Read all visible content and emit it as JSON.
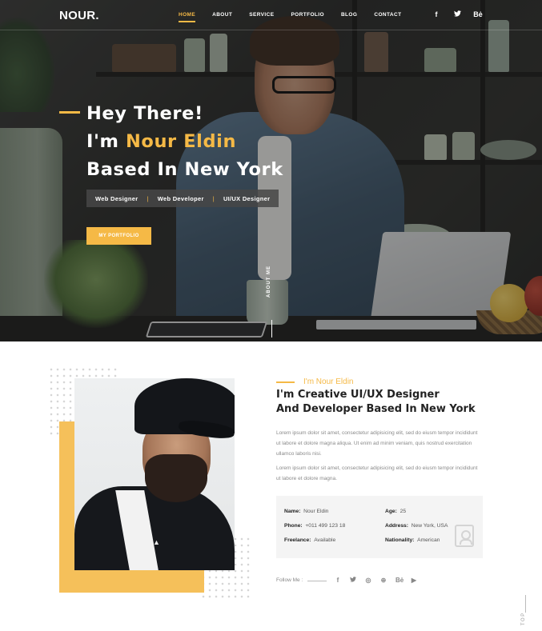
{
  "brand": {
    "logo": "NOUR."
  },
  "nav": {
    "items": [
      "HOME",
      "ABOUT",
      "SERVICE",
      "PORTFOLIO",
      "BLOG",
      "CONTACT"
    ],
    "active": "HOME",
    "socials": [
      {
        "icon": "facebook-icon",
        "glyph": "f"
      },
      {
        "icon": "twitter-icon",
        "glyph": "❧"
      },
      {
        "icon": "behance-icon",
        "glyph": "Bė"
      }
    ]
  },
  "hero": {
    "line1": "Hey There!",
    "line2_prefix": "I'm ",
    "line2_name": "Nour Eldin",
    "line3": "Based In New York",
    "roles": [
      "Web Designer",
      "Web Developer",
      "UI/UX Designer"
    ],
    "role_separator": "|",
    "button": "MY PORTFOLIO",
    "scroll_label": "ABOUT ME"
  },
  "about": {
    "name": "I'm Nour Eldin",
    "title_line1": "I'm Creative UI/UX Designer",
    "title_line2": "And Developer Based In New York",
    "paragraph1": "Lorem ipsum dolor sit amet, consectetur adipisicing elit, sed do eiusm tempor incididunt ut labore et dolore magna aliqua. Ut enim ad minim veniam, quis nostrud exercitation ullamco laboris nisi.",
    "paragraph2": "Lorem ipsum dolor sit amet, consectetur adipisicing elit, sed do eiusm tempor incididunt ut labore et dolore magna.",
    "info": {
      "name_label": "Name:",
      "name_value": "Nour Eldin",
      "age_label": "Age:",
      "age_value": "25",
      "phone_label": "Phone:",
      "phone_value": "+011 499 123 18",
      "address_label": "Address:",
      "address_value": "New York, USA",
      "freelance_label": "Freelance:",
      "freelance_value": "Available",
      "nationality_label": "Nationality:",
      "nationality_value": "American"
    },
    "follow_label": "Follow Me :",
    "socials": [
      {
        "icon": "facebook-icon",
        "glyph": "f"
      },
      {
        "icon": "twitter-icon",
        "glyph": "❧"
      },
      {
        "icon": "instagram-icon",
        "glyph": "◎"
      },
      {
        "icon": "dribbble-icon",
        "glyph": "⊕"
      },
      {
        "icon": "behance-icon",
        "glyph": "Bė"
      },
      {
        "icon": "youtube-icon",
        "glyph": "▶"
      }
    ]
  },
  "scroll_top": "TOP",
  "colors": {
    "accent": "#f5b946",
    "dark": "#222222",
    "muted": "#8a8a8a",
    "panel": "#f4f4f4"
  }
}
